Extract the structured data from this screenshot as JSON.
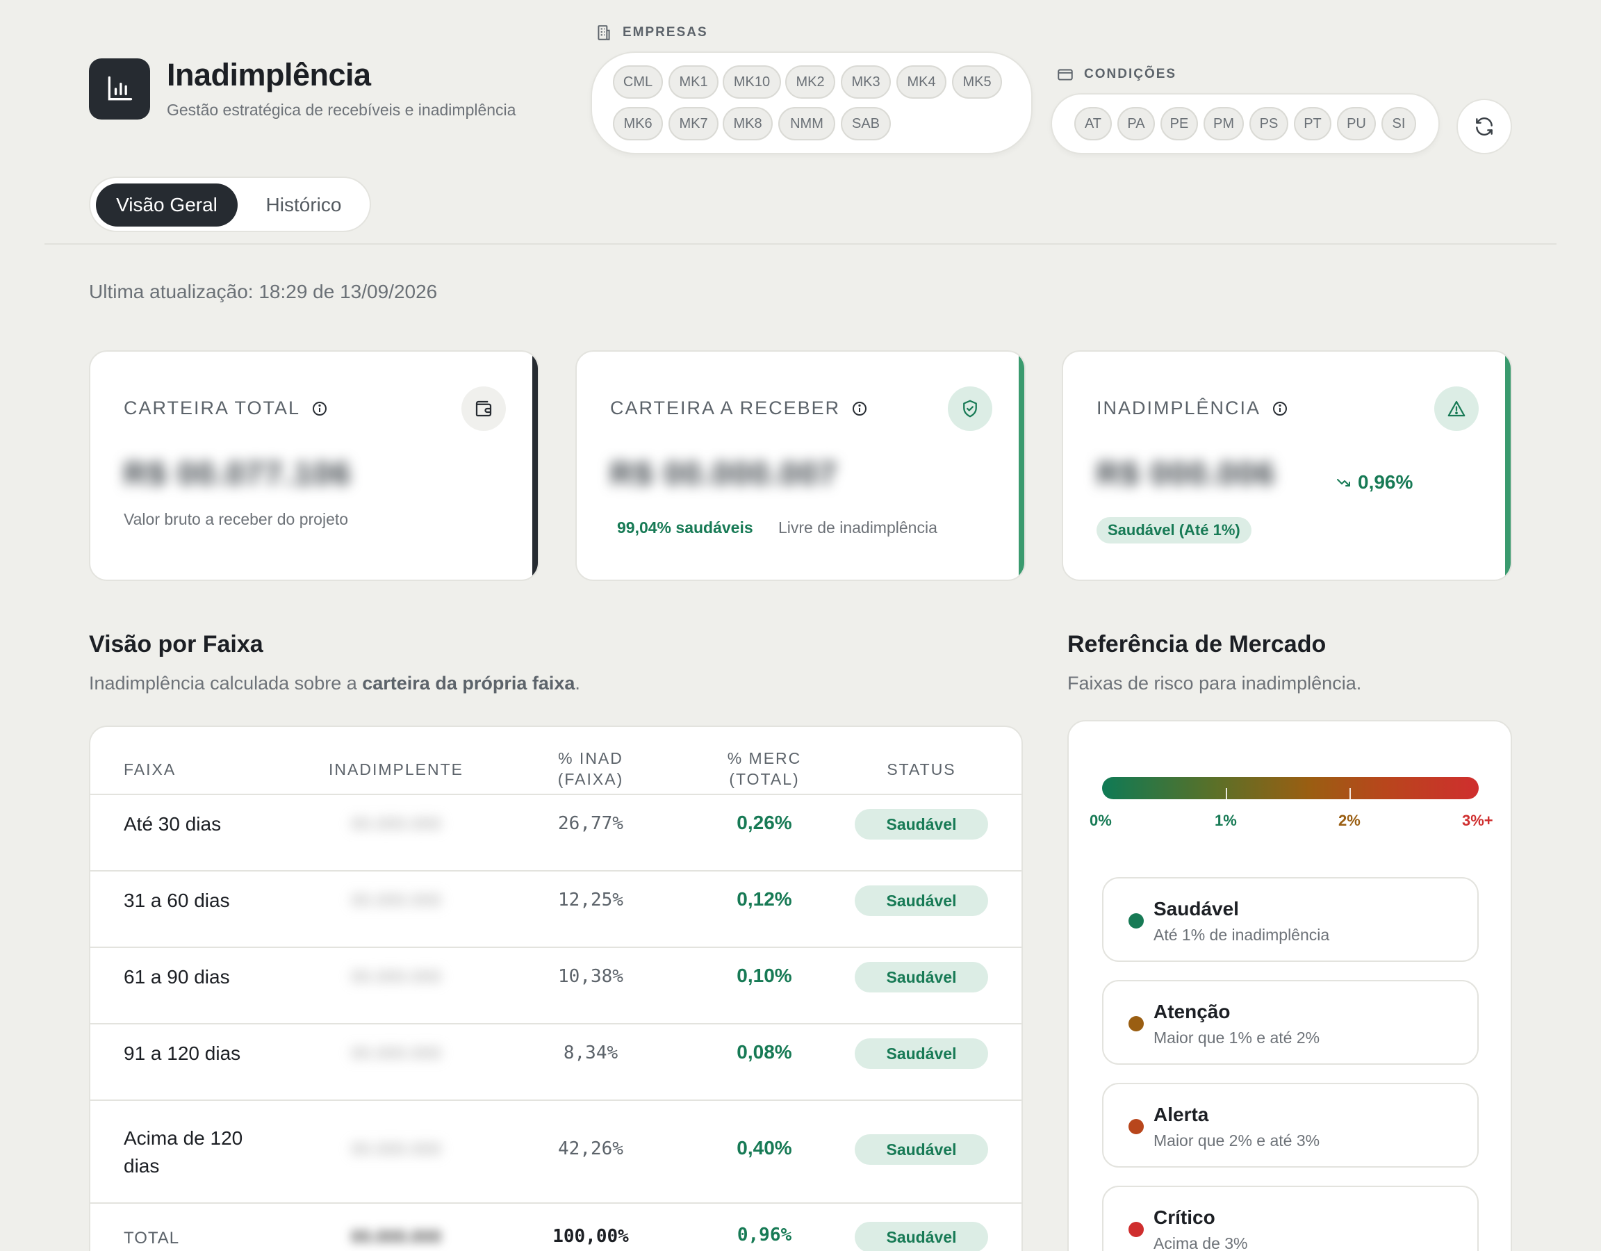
{
  "header": {
    "title": "Inadimplência",
    "subtitle": "Gestão estratégica de recebíveis e inadimplência",
    "icon": "bar-chart-icon"
  },
  "filters": {
    "empresas_label": "EMPRESAS",
    "empresas": [
      "CML",
      "MK1",
      "MK10",
      "MK2",
      "MK3",
      "MK4",
      "MK5",
      "MK6",
      "MK7",
      "MK8",
      "NMM",
      "SAB"
    ],
    "condicoes_label": "CONDIÇÕES",
    "condicoes": [
      "AT",
      "PA",
      "PE",
      "PM",
      "PS",
      "PT",
      "PU",
      "SI"
    ]
  },
  "tabs": [
    {
      "label": "Visão Geral",
      "active": true
    },
    {
      "label": "Histórico",
      "active": false
    }
  ],
  "last_update": "Ultima atualização: 18:29 de 13/09/2026",
  "kpis": {
    "carteira_total": {
      "label": "CARTEIRA TOTAL",
      "value": "R$ 00.077.106",
      "note": "Valor bruto a receber do projeto",
      "accent": "#262b31"
    },
    "carteira_receber": {
      "label": "CARTEIRA A RECEBER",
      "value": "R$ 00.000.007",
      "saudaveis": "99,04% saudáveis",
      "note": "Livre de inadimplência",
      "accent": "#3a9a6e"
    },
    "inadimplencia": {
      "label": "INADIMPLÊNCIA",
      "value": "R$ 000.006",
      "trend": "0,96%",
      "badge": "Saudável (Até 1%)",
      "accent": "#3a9a6e"
    }
  },
  "faixa_section": {
    "title": "Visão por Faixa",
    "subtitle_pre": "Inadimplência calculada sobre a ",
    "subtitle_bold": "carteira da própria faixa",
    "subtitle_post": ".",
    "columns": [
      "FAIXA",
      "INADIMPLENTE",
      "% INAD\n(FAIXA)",
      "% MERC\n(TOTAL)",
      "STATUS"
    ],
    "rows": [
      {
        "faixa": "Até 30 dias",
        "inad": "00.000.000",
        "pct_faixa": "26,77%",
        "pct_merc": "0,26%",
        "status": "Saudável"
      },
      {
        "faixa": "31 a 60 dias",
        "inad": "00.000.000",
        "pct_faixa": "12,25%",
        "pct_merc": "0,12%",
        "status": "Saudável"
      },
      {
        "faixa": "61 a 90 dias",
        "inad": "00.000.000",
        "pct_faixa": "10,38%",
        "pct_merc": "0,10%",
        "status": "Saudável"
      },
      {
        "faixa": "91 a 120 dias",
        "inad": "00.000.000",
        "pct_faixa": "8,34%",
        "pct_merc": "0,08%",
        "status": "Saudável"
      },
      {
        "faixa": "Acima de 120 dias",
        "inad": "00.000.000",
        "pct_faixa": "42,26%",
        "pct_merc": "0,40%",
        "status": "Saudável"
      }
    ],
    "total": {
      "faixa": "TOTAL",
      "inad": "00.000.000",
      "pct_faixa": "100,00%",
      "pct_merc": "0,96%",
      "status": "Saudável"
    }
  },
  "referencia": {
    "title": "Referência de Mercado",
    "subtitle": "Faixas de risco para inadimplência.",
    "scale": [
      {
        "label": "0%",
        "color": "#177a55"
      },
      {
        "label": "1%",
        "color": "#177a55"
      },
      {
        "label": "2%",
        "color": "#9a5e12"
      },
      {
        "label": "3%+",
        "color": "#cf2e2e"
      }
    ],
    "levels": [
      {
        "name": "Saudável",
        "desc": "Até 1% de inadimplência",
        "color": "#177a55"
      },
      {
        "name": "Atenção",
        "desc": "Maior que 1% e até 2%",
        "color": "#9a5e12"
      },
      {
        "name": "Alerta",
        "desc": "Maior que 2% e até 3%",
        "color": "#b8461c"
      },
      {
        "name": "Crítico",
        "desc": "Acima de 3%",
        "color": "#cf2e2e"
      }
    ]
  }
}
